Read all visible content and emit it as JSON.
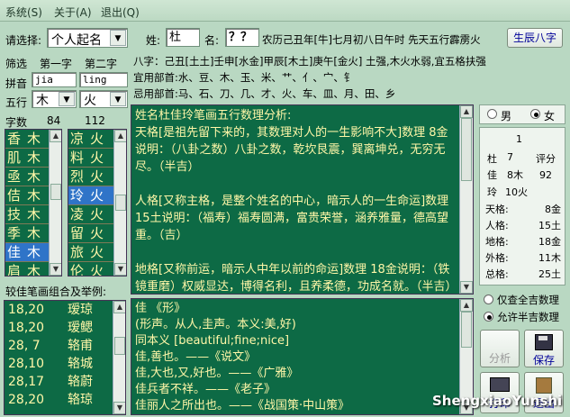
{
  "menu": [
    "系统(S)",
    "关于(A)",
    "退出(Q)"
  ],
  "form": {
    "select_label": "请选择:",
    "select_value": "个人起名",
    "surname_label": "姓:",
    "surname_value": "杜",
    "given_label": "名:",
    "given_value": "？？",
    "lunar_date": "农历己丑年[牛]七月初八日午时  先天五行霹雳火",
    "bazi_button": "生辰八字"
  },
  "bazi": {
    "line1": "八字：己丑[土土]壬申[水金]甲辰[木土]庚午[金火]  土强,木火水弱,宜五格扶强",
    "suitable": "宜用部首:水、豆、木、玉、米、艹、亻、宀、钅",
    "avoid": "忌用部首:马、石、刀、几、才、火、车、皿、月、田、乡"
  },
  "filter": {
    "title": "筛选",
    "first_label": "第一字",
    "second_label": "第二字",
    "pinyin_label": "拼音",
    "pinyin1": "jia",
    "pinyin2": "ling",
    "wuxing_label": "五行",
    "wuxing1": "木",
    "wuxing2": "火",
    "stroke_label": "字数",
    "count1": "84",
    "count2": "112"
  },
  "list1": [
    {
      "c": "香",
      "w": "木"
    },
    {
      "c": "肌",
      "w": "木"
    },
    {
      "c": "亟",
      "w": "木"
    },
    {
      "c": "佶",
      "w": "木"
    },
    {
      "c": "技",
      "w": "木"
    },
    {
      "c": "季",
      "w": "木"
    },
    {
      "c": "佳",
      "w": "木"
    },
    {
      "c": "肩",
      "w": "木"
    },
    {
      "c": "茧",
      "w": "木"
    }
  ],
  "list2": [
    {
      "c": "凉",
      "w": "火"
    },
    {
      "c": "料",
      "w": "火"
    },
    {
      "c": "烈",
      "w": "火"
    },
    {
      "c": "玲",
      "w": "火"
    },
    {
      "c": "凌",
      "w": "火"
    },
    {
      "c": "留",
      "w": "火"
    },
    {
      "c": "旅",
      "w": "火"
    },
    {
      "c": "伦",
      "w": "火"
    },
    {
      "c": "偎",
      "w": "火"
    }
  ],
  "combos": {
    "title": "较佳笔画组合及举例:",
    "rows": [
      {
        "n": "18,20",
        "e": "瑷琼"
      },
      {
        "n": "18,20",
        "e": "瑷鳃"
      },
      {
        "n": "28, 7",
        "e": "辂甫"
      },
      {
        "n": "28,10",
        "e": "辂城"
      },
      {
        "n": "28,17",
        "e": "辂蔚"
      },
      {
        "n": "28,20",
        "e": "辂琼"
      }
    ]
  },
  "analysis": {
    "title": "姓名杜佳玲笔画五行数理分析:",
    "p1": "天格[是祖先留下来的，其数理对人的一生影响不大]数理  8金说明：（八卦之数）八卦之数，乾坎艮震，巽离坤兑，无穷无尽。（半吉）",
    "p2": "人格[又称主格，是整个姓名的中心，暗示人的一生命运]数理 15土说明：（福寿）福寿圆满，富贵荣誉，涵养雅量，德高望重。（吉）",
    "p3": "地格[又称前运，暗示人中年以前的命运]数理 18金说明：（铁镜重磨）权威显达，博得名利，且养柔德，功成名就。（半吉）"
  },
  "dictionary": {
    "l1": "佳 《形》",
    "l2": "(形声。从人,圭声。本义:美,好)",
    "l3": "同本义 [beautiful;fine;nice]",
    "l4": "佳,善也。——《说文》",
    "l5": "佳,大也,又,好也。——《广雅》",
    "l6": "佳兵者不祥。——《老子》",
    "l7": "佳丽人之所出也。——《战国策·中山策》"
  },
  "result": {
    "male": "男",
    "female": "女",
    "line_top": "1",
    "c1": "杜",
    "s1": "7",
    "score_label": "评分",
    "c2": "佳",
    "s2": "8木",
    "score": "92",
    "c3": "玲",
    "s3": "10火",
    "grid": [
      {
        "k": "天格:",
        "v": "8金"
      },
      {
        "k": "人格:",
        "v": "15土"
      },
      {
        "k": "地格:",
        "v": "18金"
      },
      {
        "k": "外格:",
        "v": "11木"
      },
      {
        "k": "总格:",
        "v": "25土"
      }
    ]
  },
  "options": {
    "only_lucky": "仅查全吉数理",
    "allow_half": "允许半吉数理"
  },
  "buttons": {
    "analyze": "分析",
    "save": "保存",
    "print": "打印",
    "back": "退出"
  },
  "watermark": "ShengxiaoYunshi"
}
